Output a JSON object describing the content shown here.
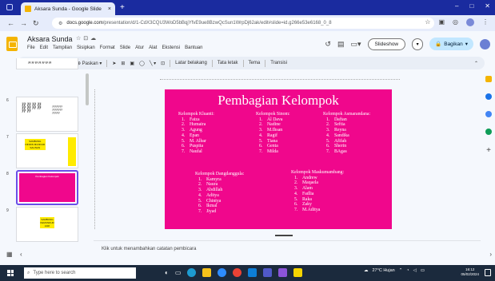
{
  "browser": {
    "tab_title": "Aksara Sunda - Google Slide",
    "tab_close": "×",
    "new_tab": "+",
    "url_domain": "docs.google.com",
    "url_path": "/presentation/d/1-CdX3CQU3WoD5bBqjYfvE9ue8BzwQcSun1WrpDj62ak/edit#slide=id.g266e53e6168_0_8",
    "window_controls": [
      "‒",
      "□",
      "✕"
    ]
  },
  "app": {
    "doc_title": "Aksara Sunda",
    "menu": [
      "File",
      "Edit",
      "Tampilan",
      "Sisipkan",
      "Format",
      "Slide",
      "Atur",
      "Alat",
      "Ekstensi",
      "Bantuan"
    ],
    "slideshow_label": "Slideshow",
    "share_label": "Bagikan"
  },
  "toolbar": {
    "zoom_label": "Paskan",
    "background_label": "Latar belakang",
    "layout_label": "Tata letak",
    "theme_label": "Tema",
    "transition_label": "Transisi"
  },
  "filmstrip": {
    "thumbs": [
      {
        "num": "6"
      },
      {
        "num": "7",
        "text": "SAMBUNG DINDIN MUNDUR SALINAN"
      },
      {
        "num": "8",
        "text": "Pembagian Kelompok"
      },
      {
        "num": "9",
        "text": "SAMBUNG KEMUNDUR JARI"
      }
    ]
  },
  "slide": {
    "title": "Pembagian Kelompok",
    "groups": [
      {
        "heading": "Kelompok Kluanti:",
        "members": [
          "Faiza",
          "Humaira",
          "Agung",
          "Epan",
          "M. Albar",
          "Puspita",
          "Naufal"
        ]
      },
      {
        "heading": "Kelompok Sinom:",
        "members": [
          "Al Dava",
          "Nadine",
          "M.Ihsan",
          "Ragif",
          "Tiana",
          "Genta",
          "Milda"
        ]
      },
      {
        "heading": "Kelompok Asmarandana:",
        "members": [
          "Daftan",
          "Seftia",
          "Reyna",
          "Sandika",
          "Afifah",
          "Sherin",
          "BAgas"
        ]
      },
      {
        "heading": "Kelompok Dangdanggula:",
        "members": [
          "Kamyra",
          "Naura",
          "Abdillah",
          "Aditya",
          "Chintya",
          "Ikmal",
          "Jiyad"
        ]
      },
      {
        "heading": "Kelompok Maskumambang:",
        "members": [
          "Andrew",
          "Maqaela",
          "Alam",
          "Fadlia",
          "Raka",
          "Zaky",
          "M.Aditya"
        ]
      }
    ]
  },
  "notes": {
    "placeholder": "Klik untuk menambahkan catatan pembicara"
  },
  "taskbar": {
    "search_placeholder": "Type here to search",
    "weather": "27°C Hujan",
    "time": "16:12",
    "date": "05/02/2024"
  },
  "colors": {
    "slide_bg": "#f0078c",
    "browser_bar": "#1a2b9f",
    "share_btn": "#c2e7ff",
    "thumb_yellow": "#ffeb00"
  }
}
